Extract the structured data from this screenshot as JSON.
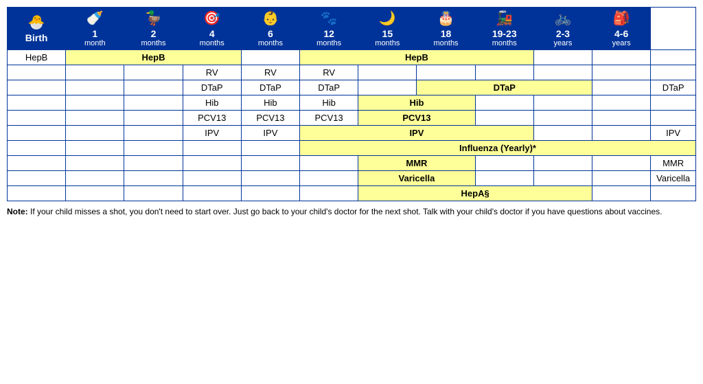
{
  "headers": [
    {
      "id": "birth",
      "age": "Birth",
      "sub": "",
      "icon": "🐣"
    },
    {
      "id": "1mo",
      "age": "1",
      "sub": "month",
      "icon": "🍼"
    },
    {
      "id": "2mo",
      "age": "2",
      "sub": "months",
      "icon": "🦆"
    },
    {
      "id": "4mo",
      "age": "4",
      "sub": "months",
      "icon": "🎯"
    },
    {
      "id": "6mo",
      "age": "6",
      "sub": "months",
      "icon": "👶"
    },
    {
      "id": "12mo",
      "age": "12",
      "sub": "months",
      "icon": "🐾"
    },
    {
      "id": "15mo",
      "age": "15",
      "sub": "months",
      "icon": "🌙"
    },
    {
      "id": "18mo",
      "age": "18",
      "sub": "months",
      "icon": "🎂"
    },
    {
      "id": "19-23mo",
      "age": "19-23",
      "sub": "months",
      "icon": "🚂"
    },
    {
      "id": "2-3yr",
      "age": "2-3",
      "sub": "years",
      "icon": "🚲"
    },
    {
      "id": "4-6yr",
      "age": "4-6",
      "sub": "years",
      "icon": "🎒"
    }
  ],
  "rows": [
    {
      "vaccine": "HepB",
      "cells": [
        {
          "type": "yellow",
          "text": "HepB",
          "colspan": 3,
          "id": "hepb-birth-2mo"
        },
        {
          "type": "empty",
          "text": "",
          "id": "hepb-4mo"
        },
        {
          "type": "yellow",
          "text": "HepB",
          "colspan": 4,
          "id": "hepb-6mo-18mo"
        },
        {
          "type": "empty",
          "text": "",
          "id": "hepb-1923mo"
        },
        {
          "type": "empty",
          "text": "",
          "id": "hepb-23yr"
        },
        {
          "type": "empty",
          "text": "",
          "id": "hepb-46yr"
        }
      ]
    },
    {
      "vaccine": "",
      "cells": [
        {
          "type": "empty",
          "text": "",
          "id": "rv-birth"
        },
        {
          "type": "empty",
          "text": "",
          "id": "rv-1mo"
        },
        {
          "type": "label",
          "text": "RV",
          "id": "rv-2mo"
        },
        {
          "type": "label",
          "text": "RV",
          "id": "rv-4mo"
        },
        {
          "type": "label",
          "text": "RV",
          "id": "rv-6mo"
        },
        {
          "type": "empty",
          "text": "",
          "id": "rv-12mo"
        },
        {
          "type": "empty",
          "text": "",
          "id": "rv-15mo"
        },
        {
          "type": "empty",
          "text": "",
          "id": "rv-18mo"
        },
        {
          "type": "empty",
          "text": "",
          "id": "rv-1923mo"
        },
        {
          "type": "empty",
          "text": "",
          "id": "rv-23yr"
        },
        {
          "type": "empty",
          "text": "",
          "id": "rv-46yr"
        }
      ]
    },
    {
      "vaccine": "",
      "cells": [
        {
          "type": "empty",
          "text": "",
          "id": "dtap-birth"
        },
        {
          "type": "empty",
          "text": "",
          "id": "dtap-1mo"
        },
        {
          "type": "label",
          "text": "DTaP",
          "id": "dtap-2mo"
        },
        {
          "type": "label",
          "text": "DTaP",
          "id": "dtap-4mo"
        },
        {
          "type": "label",
          "text": "DTaP",
          "id": "dtap-6mo"
        },
        {
          "type": "empty",
          "text": "",
          "id": "dtap-12mo"
        },
        {
          "type": "yellow",
          "text": "DTaP",
          "colspan": 3,
          "id": "dtap-15mo-1923mo"
        },
        {
          "type": "empty",
          "text": "",
          "id": "dtap-23yr"
        },
        {
          "type": "label",
          "text": "DTaP",
          "id": "dtap-46yr"
        }
      ]
    },
    {
      "vaccine": "",
      "cells": [
        {
          "type": "empty",
          "text": "",
          "id": "hib-birth"
        },
        {
          "type": "empty",
          "text": "",
          "id": "hib-1mo"
        },
        {
          "type": "label",
          "text": "Hib",
          "id": "hib-2mo"
        },
        {
          "type": "label",
          "text": "Hib",
          "id": "hib-4mo"
        },
        {
          "type": "label",
          "text": "Hib",
          "id": "hib-6mo"
        },
        {
          "type": "yellow",
          "text": "Hib",
          "colspan": 2,
          "id": "hib-12mo-15mo"
        },
        {
          "type": "empty",
          "text": "",
          "id": "hib-18mo"
        },
        {
          "type": "empty",
          "text": "",
          "id": "hib-1923mo"
        },
        {
          "type": "empty",
          "text": "",
          "id": "hib-23yr"
        },
        {
          "type": "empty",
          "text": "",
          "id": "hib-46yr"
        }
      ]
    },
    {
      "vaccine": "",
      "cells": [
        {
          "type": "empty",
          "text": "",
          "id": "pcv-birth"
        },
        {
          "type": "empty",
          "text": "",
          "id": "pcv-1mo"
        },
        {
          "type": "label",
          "text": "PCV13",
          "id": "pcv-2mo"
        },
        {
          "type": "label",
          "text": "PCV13",
          "id": "pcv-4mo"
        },
        {
          "type": "label",
          "text": "PCV13",
          "id": "pcv-6mo"
        },
        {
          "type": "yellow",
          "text": "PCV13",
          "colspan": 2,
          "id": "pcv-12mo-15mo"
        },
        {
          "type": "empty",
          "text": "",
          "id": "pcv-18mo"
        },
        {
          "type": "empty",
          "text": "",
          "id": "pcv-1923mo"
        },
        {
          "type": "empty",
          "text": "",
          "id": "pcv-23yr"
        },
        {
          "type": "empty",
          "text": "",
          "id": "pcv-46yr"
        }
      ]
    },
    {
      "vaccine": "",
      "cells": [
        {
          "type": "empty",
          "text": "",
          "id": "ipv-birth"
        },
        {
          "type": "empty",
          "text": "",
          "id": "ipv-1mo"
        },
        {
          "type": "label",
          "text": "IPV",
          "id": "ipv-2mo"
        },
        {
          "type": "label",
          "text": "IPV",
          "id": "ipv-4mo"
        },
        {
          "type": "yellow",
          "text": "IPV",
          "colspan": 4,
          "id": "ipv-6mo-18mo"
        },
        {
          "type": "empty",
          "text": "",
          "id": "ipv-1923mo"
        },
        {
          "type": "empty",
          "text": "",
          "id": "ipv-23yr"
        },
        {
          "type": "label",
          "text": "IPV",
          "id": "ipv-46yr"
        }
      ]
    },
    {
      "vaccine": "",
      "cells": [
        {
          "type": "empty",
          "text": "",
          "id": "flu-birth"
        },
        {
          "type": "empty",
          "text": "",
          "id": "flu-1mo"
        },
        {
          "type": "empty",
          "text": "",
          "id": "flu-2mo"
        },
        {
          "type": "empty",
          "text": "",
          "id": "flu-4mo"
        },
        {
          "type": "yellow",
          "text": "Influenza (Yearly)*",
          "colspan": 7,
          "id": "flu-6mo-46yr"
        }
      ]
    },
    {
      "vaccine": "",
      "cells": [
        {
          "type": "empty",
          "text": "",
          "id": "mmr-birth"
        },
        {
          "type": "empty",
          "text": "",
          "id": "mmr-1mo"
        },
        {
          "type": "empty",
          "text": "",
          "id": "mmr-2mo"
        },
        {
          "type": "empty",
          "text": "",
          "id": "mmr-4mo"
        },
        {
          "type": "empty",
          "text": "",
          "id": "mmr-6mo"
        },
        {
          "type": "yellow",
          "text": "MMR",
          "colspan": 2,
          "id": "mmr-12mo-15mo"
        },
        {
          "type": "empty",
          "text": "",
          "id": "mmr-18mo"
        },
        {
          "type": "empty",
          "text": "",
          "id": "mmr-1923mo"
        },
        {
          "type": "empty",
          "text": "",
          "id": "mmr-23yr"
        },
        {
          "type": "label",
          "text": "MMR",
          "id": "mmr-46yr"
        }
      ]
    },
    {
      "vaccine": "",
      "cells": [
        {
          "type": "empty",
          "text": "",
          "id": "var-birth"
        },
        {
          "type": "empty",
          "text": "",
          "id": "var-1mo"
        },
        {
          "type": "empty",
          "text": "",
          "id": "var-2mo"
        },
        {
          "type": "empty",
          "text": "",
          "id": "var-4mo"
        },
        {
          "type": "empty",
          "text": "",
          "id": "var-6mo"
        },
        {
          "type": "yellow",
          "text": "Varicella",
          "colspan": 2,
          "id": "var-12mo-15mo"
        },
        {
          "type": "empty",
          "text": "",
          "id": "var-18mo"
        },
        {
          "type": "empty",
          "text": "",
          "id": "var-1923mo"
        },
        {
          "type": "empty",
          "text": "",
          "id": "var-23yr"
        },
        {
          "type": "label",
          "text": "Varicella",
          "id": "var-46yr"
        }
      ]
    },
    {
      "vaccine": "",
      "cells": [
        {
          "type": "empty",
          "text": "",
          "id": "hepa-birth"
        },
        {
          "type": "empty",
          "text": "",
          "id": "hepa-1mo"
        },
        {
          "type": "empty",
          "text": "",
          "id": "hepa-2mo"
        },
        {
          "type": "empty",
          "text": "",
          "id": "hepa-4mo"
        },
        {
          "type": "empty",
          "text": "",
          "id": "hepa-6mo"
        },
        {
          "type": "yellow",
          "text": "HepA§",
          "colspan": 4,
          "id": "hepa-12mo-1923mo"
        },
        {
          "type": "empty",
          "text": "",
          "id": "hepa-23yr"
        },
        {
          "type": "empty",
          "text": "",
          "id": "hepa-46yr"
        }
      ]
    }
  ],
  "note": {
    "bold": "Note:",
    "text": " If your child misses a shot, you don't need to start over. Just go back to your child's doctor for the next shot. Talk with your child's doctor if you have questions about vaccines."
  },
  "colors": {
    "header_bg": "#003399",
    "header_text": "#ffffff",
    "yellow_bg": "#FFFF99",
    "border": "#003399"
  }
}
